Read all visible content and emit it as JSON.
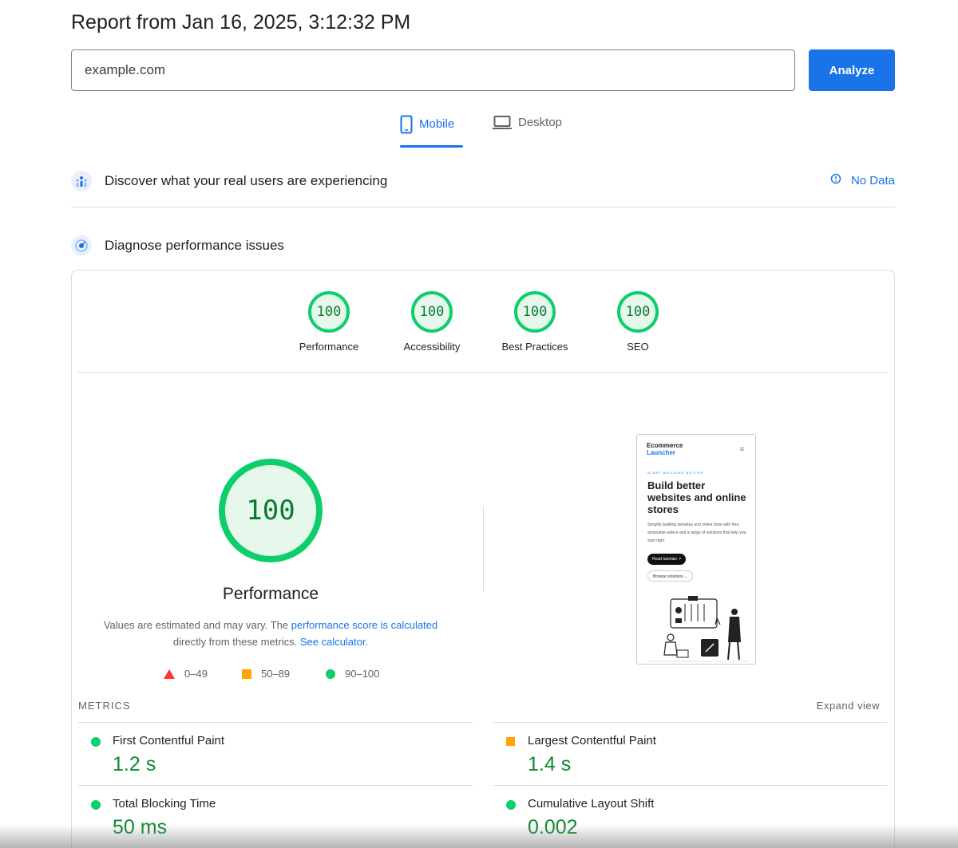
{
  "header": {
    "title": "Report from Jan 16, 2025, 3:12:32 PM"
  },
  "search": {
    "value": "example.com",
    "analyze_label": "Analyze"
  },
  "tabs": [
    {
      "label": "Mobile",
      "active": true
    },
    {
      "label": "Desktop",
      "active": false
    }
  ],
  "crux": {
    "title": "Discover what your real users are experiencing",
    "status": "No Data"
  },
  "diagnose": {
    "title": "Diagnose performance issues"
  },
  "scores": [
    {
      "value": "100",
      "label": "Performance"
    },
    {
      "value": "100",
      "label": "Accessibility"
    },
    {
      "value": "100",
      "label": "Best Practices"
    },
    {
      "value": "100",
      "label": "SEO"
    }
  ],
  "performance": {
    "score": "100",
    "title": "Performance",
    "desc_prefix": "Values are estimated and may vary. The ",
    "desc_link1": "performance score is calculated",
    "desc_middle": " directly from these metrics. ",
    "desc_link2": "See calculator."
  },
  "legend": [
    {
      "range": "0–49"
    },
    {
      "range": "50–89"
    },
    {
      "range": "90–100"
    }
  ],
  "screenshot": {
    "brand_line1": "Ecommerce",
    "brand_line2": "Launcher",
    "menu": "≡",
    "kicker": "START BUILDING BETTER",
    "headline": "Build better websites and online stores",
    "body": "Simplify building websites and online store with free, actionable advice and a range of solutions that help you start right.",
    "btn_primary": "Read tutorials ↗",
    "btn_secondary": "Browse solutions ⌄"
  },
  "metrics": {
    "label": "METRICS",
    "expand_label": "Expand view",
    "items": [
      {
        "name": "First Contentful Paint",
        "value": "1.2 s",
        "status": "good"
      },
      {
        "name": "Largest Contentful Paint",
        "value": "1.4 s",
        "status": "average"
      },
      {
        "name": "Total Blocking Time",
        "value": "50 ms",
        "status": "good"
      },
      {
        "name": "Cumulative Layout Shift",
        "value": "0.002",
        "status": "good"
      }
    ]
  },
  "colors": {
    "accent": "#1a73e8",
    "pass": "#0cce6b",
    "average": "#ffa400",
    "fail": "#ff3333"
  }
}
